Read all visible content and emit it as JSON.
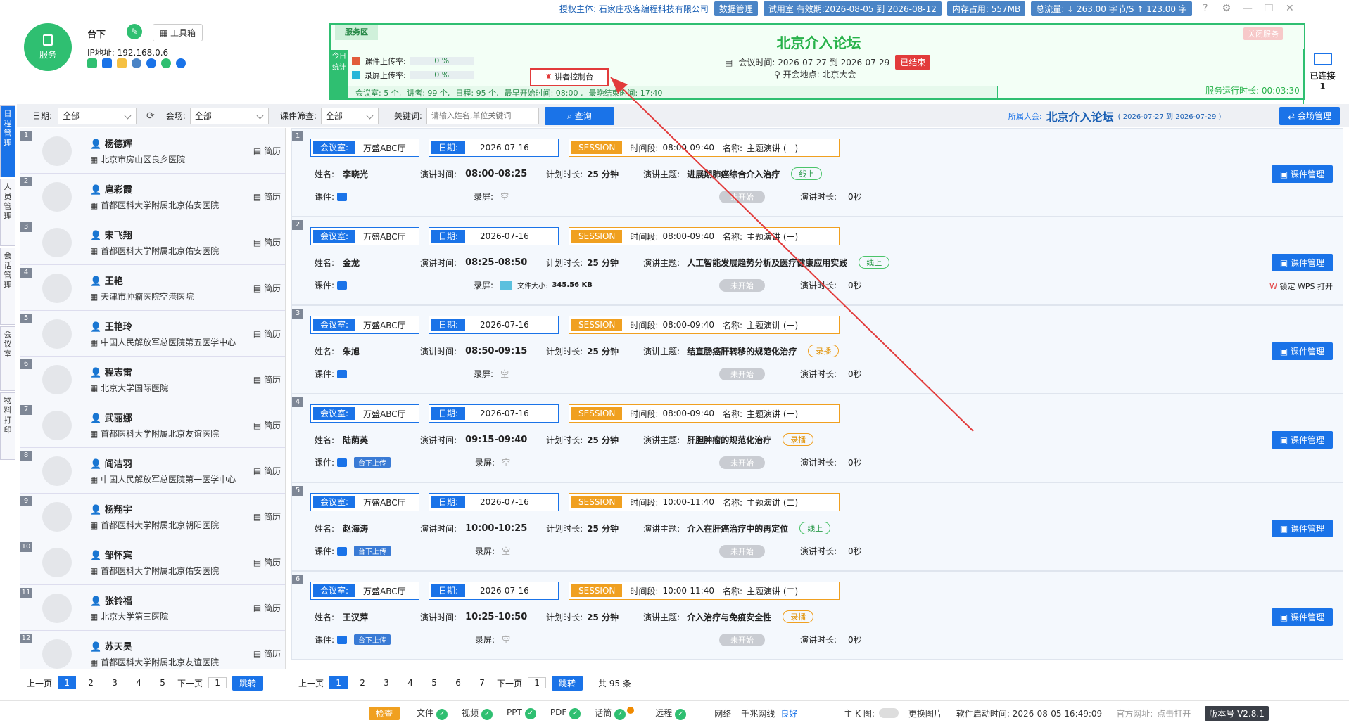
{
  "topbar": {
    "licensee": "授权主体: 石家庄极客编程科技有限公司",
    "data_mgmt": "数据管理",
    "trial": "试用室 有效期:2026-08-05 到 2026-08-12",
    "memory": "内存占用: 557MB",
    "traffic": "总流量: ↓ 263.00 字节/S  ↑ 123.00 字"
  },
  "host": {
    "service_label": "服务",
    "name": "台下",
    "toolbox": "工具箱",
    "ip": "IP地址: 192.168.0.6"
  },
  "service_area": {
    "tag": "服务区",
    "stats_label": "今日统计",
    "upload_courseware": "课件上传率:",
    "upload_courseware_pct": "0 %",
    "upload_record": "录屏上传率:",
    "upload_record_pct": "0 %",
    "controller_btn": "讲者控制台",
    "summary": [
      "会议室: 5 个,",
      "讲者: 99 个,",
      "日程: 95 个,",
      "最早开始时间: 08:00 ,",
      "最晚结束时间: 17:40"
    ],
    "forum_title": "北京介入论坛",
    "meeting_time": "会议时间: 2026-07-27  到  2026-07-29",
    "ended": "已结束",
    "place": "开会地点: 北京大会",
    "close_service": "关闭服务",
    "runtime": "服务运行时长: 00:03:30",
    "connected": "已连接",
    "connected_count": "1"
  },
  "nav": [
    "日程管理",
    "人员管理",
    "会话管理",
    "会议室",
    "物料打印"
  ],
  "filters": {
    "date_label": "日期:",
    "date_value": "全部",
    "venue_label": "会场:",
    "venue_value": "全部",
    "courseware_label": "课件筛查:",
    "courseware_value": "全部",
    "keyword_label": "关键词:",
    "keyword_placeholder": "请输入姓名,单位关键词",
    "search": "查询",
    "conference_label": "所属大会:",
    "conference_name": "北京介入论坛",
    "conference_range": "( 2026-07-27 到 2026-07-29 )",
    "venue_mgmt": "会场管理"
  },
  "speakers": [
    {
      "n": "1",
      "name": "杨德辉",
      "org": "北京市房山区良乡医院",
      "cv": "简历"
    },
    {
      "n": "2",
      "name": "扈彩霞",
      "org": "首都医科大学附属北京佑安医院",
      "cv": "简历"
    },
    {
      "n": "3",
      "name": "宋飞翔",
      "org": "首都医科大学附属北京佑安医院",
      "cv": "简历"
    },
    {
      "n": "4",
      "name": "王艳",
      "org": "天津市肿瘤医院空港医院",
      "cv": "简历"
    },
    {
      "n": "5",
      "name": "王艳玲",
      "org": "中国人民解放军总医院第五医学中心",
      "cv": "简历"
    },
    {
      "n": "6",
      "name": "程志雷",
      "org": "北京大学国际医院",
      "cv": "简历"
    },
    {
      "n": "7",
      "name": "武丽娜",
      "org": "首都医科大学附属北京友谊医院",
      "cv": "简历"
    },
    {
      "n": "8",
      "name": "阎洁羽",
      "org": "中国人民解放军总医院第一医学中心",
      "cv": "简历"
    },
    {
      "n": "9",
      "name": "杨翔宇",
      "org": "首都医科大学附属北京朝阳医院",
      "cv": "简历"
    },
    {
      "n": "10",
      "name": "邹怀宾",
      "org": "首都医科大学附属北京佑安医院",
      "cv": "简历"
    },
    {
      "n": "11",
      "name": "张铃福",
      "org": "北京大学第三医院",
      "cv": "简历"
    },
    {
      "n": "12",
      "name": "苏天昊",
      "org": "首都医科大学附属北京友谊医院",
      "cv": "简历"
    }
  ],
  "speaker_pager": {
    "prev": "上一页",
    "pages": [
      "1",
      "2",
      "3",
      "4",
      "5"
    ],
    "next": "下一页",
    "input": "1",
    "jump": "跳转"
  },
  "labels": {
    "room": "会议室:",
    "date": "日期:",
    "session": "SESSION",
    "period": "时间段:",
    "title": "名称:",
    "name": "姓名:",
    "talk_time": "演讲时间:",
    "plan": "计划时长:",
    "topic": "演讲主题:",
    "courseware": "课件:",
    "record": "录屏:",
    "duration": "演讲时长:",
    "mgmt": "课件管理",
    "not_started": "未开始",
    "upload": "台下上传",
    "file_size": "文件大小:",
    "wps": "锁定 WPS 打开"
  },
  "sessions": [
    {
      "n": "1",
      "room": "万盛ABC厅",
      "date": "2026-07-16",
      "period": "08:00-09:40",
      "title": "主题演讲 (一)",
      "name": "李晓光",
      "time": "08:00-08:25",
      "plan": "25 分钟",
      "topic": "进展期肺癌综合介入治疗",
      "mode": "线上",
      "record": "空",
      "dur": "0秒"
    },
    {
      "n": "2",
      "room": "万盛ABC厅",
      "date": "2026-07-16",
      "period": "08:00-09:40",
      "title": "主题演讲 (一)",
      "name": "金龙",
      "time": "08:25-08:50",
      "plan": "25 分钟",
      "topic": "人工智能发展趋势分析及医疗健康应用实践",
      "mode": "线上",
      "record": "345.56 KB",
      "dur": "0秒"
    },
    {
      "n": "3",
      "room": "万盛ABC厅",
      "date": "2026-07-16",
      "period": "08:00-09:40",
      "title": "主题演讲 (一)",
      "name": "朱旭",
      "time": "08:50-09:15",
      "plan": "25 分钟",
      "topic": "结直肠癌肝转移的规范化治疗",
      "mode": "录播",
      "record": "空",
      "dur": "0秒"
    },
    {
      "n": "4",
      "room": "万盛ABC厅",
      "date": "2026-07-16",
      "period": "08:00-09:40",
      "title": "主题演讲 (一)",
      "name": "陆荫英",
      "time": "09:15-09:40",
      "plan": "25 分钟",
      "topic": "肝胆肿瘤的规范化治疗",
      "mode": "录播",
      "record": "空",
      "dur": "0秒"
    },
    {
      "n": "5",
      "room": "万盛ABC厅",
      "date": "2026-07-16",
      "period": "10:00-11:40",
      "title": "主题演讲 (二)",
      "name": "赵海涛",
      "time": "10:00-10:25",
      "plan": "25 分钟",
      "topic": "介入在肝癌治疗中的再定位",
      "mode": "线上",
      "record": "空",
      "dur": "0秒"
    },
    {
      "n": "6",
      "room": "万盛ABC厅",
      "date": "2026-07-16",
      "period": "10:00-11:40",
      "title": "主题演讲 (二)",
      "name": "王汉萍",
      "time": "10:25-10:50",
      "plan": "25 分钟",
      "topic": "介入治疗与免疫安全性",
      "mode": "录播",
      "record": "空",
      "dur": "0秒"
    }
  ],
  "session_pager": {
    "prev": "上一页",
    "pages": [
      "1",
      "2",
      "3",
      "4",
      "5",
      "6",
      "7"
    ],
    "next": "下一页",
    "input": "1",
    "jump": "跳转",
    "total": "共 95 条"
  },
  "statusbar": {
    "check": "检查",
    "file": "文件",
    "video": "视频",
    "ppt": "PPT",
    "pdf": "PDF",
    "slides": "话筒",
    "remote": "远程",
    "network": "网络",
    "gigabit": "千兆网线",
    "good": "良好",
    "kmap": "主 K 图:",
    "change_img": "更换图片",
    "start_time": "软件启动时间: 2026-08-05 16:49:09",
    "site": "官方网址:",
    "click_open": "点击打开",
    "version": "版本号 V2.8.1"
  },
  "colors": {
    "accent": "#1a73e8",
    "green": "#2fbf71",
    "danger": "#e23b3b",
    "orange": "#f0a020"
  }
}
